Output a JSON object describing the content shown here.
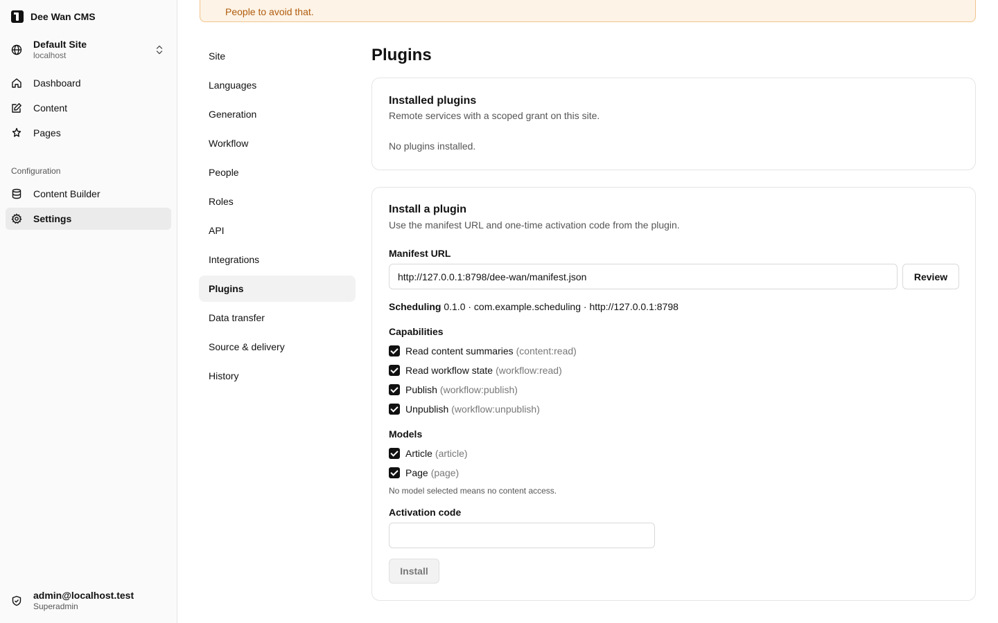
{
  "app": {
    "name": "Dee Wan CMS"
  },
  "site": {
    "name": "Default Site",
    "host": "localhost"
  },
  "sidebar": {
    "main": [
      {
        "label": "Dashboard",
        "icon": "home-icon"
      },
      {
        "label": "Content",
        "icon": "edit-icon"
      },
      {
        "label": "Pages",
        "icon": "pages-icon"
      }
    ],
    "section_label": "Configuration",
    "config": [
      {
        "label": "Content Builder",
        "icon": "database-icon"
      },
      {
        "label": "Settings",
        "icon": "gear-icon",
        "active": true
      }
    ]
  },
  "user": {
    "email": "admin@localhost.test",
    "role": "Superadmin"
  },
  "alert": {
    "text": "People to avoid that."
  },
  "settings_nav": [
    "Site",
    "Languages",
    "Generation",
    "Workflow",
    "People",
    "Roles",
    "API",
    "Integrations",
    "Plugins",
    "Data transfer",
    "Source & delivery",
    "History"
  ],
  "settings_active": "Plugins",
  "page": {
    "title": "Plugins"
  },
  "installed": {
    "title": "Installed plugins",
    "subtitle": "Remote services with a scoped grant on this site.",
    "empty": "No plugins installed."
  },
  "install": {
    "title": "Install a plugin",
    "subtitle": "Use the manifest URL and one-time activation code from the plugin.",
    "manifest_label": "Manifest URL",
    "manifest_value": "http://127.0.0.1:8798/dee-wan/manifest.json",
    "review_label": "Review",
    "plugin_name": "Scheduling",
    "plugin_meta": " 0.1.0 · com.example.scheduling · http://127.0.0.1:8798",
    "capabilities_label": "Capabilities",
    "capabilities": [
      {
        "label": "Read content summaries",
        "scope": "(content:read)",
        "checked": true
      },
      {
        "label": "Read workflow state",
        "scope": "(workflow:read)",
        "checked": true
      },
      {
        "label": "Publish",
        "scope": "(workflow:publish)",
        "checked": true
      },
      {
        "label": "Unpublish",
        "scope": "(workflow:unpublish)",
        "checked": true
      }
    ],
    "models_label": "Models",
    "models": [
      {
        "label": "Article",
        "scope": "(article)",
        "checked": true
      },
      {
        "label": "Page",
        "scope": "(page)",
        "checked": true
      }
    ],
    "models_hint": "No model selected means no content access.",
    "activation_label": "Activation code",
    "activation_value": "",
    "install_label": "Install"
  }
}
